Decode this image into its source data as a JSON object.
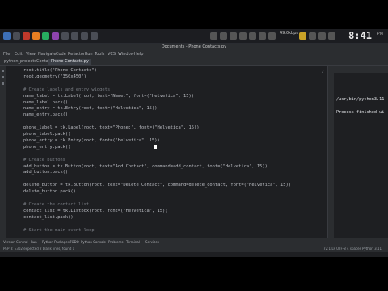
{
  "system": {
    "clock": "8:41",
    "clock_small": "PM",
    "tray_text": "49.0kbps",
    "desk_text": "0:0"
  },
  "window": {
    "title": "Documents - Phone Contacts.py"
  },
  "menu": {
    "items": [
      "File",
      "Edit",
      "View",
      "Navigate",
      "Code",
      "Refactor",
      "Run",
      "Tools",
      "VCS",
      "Window",
      "Help"
    ]
  },
  "tabs": [
    {
      "label": "python_projects"
    },
    {
      "label": "Contacts"
    },
    {
      "label": "Phone Contacts.py"
    }
  ],
  "editor": {
    "lines": [
      {
        "parts": [
          [
            "",
            "root.title(\"Phone Contacts\")"
          ]
        ]
      },
      {
        "parts": [
          [
            "",
            "root.geometry(\"350x450\")"
          ]
        ]
      },
      {
        "parts": [
          [
            "",
            ""
          ]
        ]
      },
      {
        "parts": [
          [
            "cm",
            "# Create labels and entry widgets"
          ]
        ]
      },
      {
        "parts": [
          [
            "",
            "name_label = tk.Label(root, text=\"Name:\", font=(\"Helvetica\", 15))"
          ]
        ]
      },
      {
        "parts": [
          [
            "",
            "name_label.pack()"
          ]
        ]
      },
      {
        "parts": [
          [
            "",
            "name_entry = tk.Entry(root, font=(\"Helvetica\", 15))"
          ]
        ]
      },
      {
        "parts": [
          [
            "",
            "name_entry.pack()"
          ]
        ]
      },
      {
        "parts": [
          [
            "",
            ""
          ]
        ]
      },
      {
        "parts": [
          [
            "",
            "phone_label = tk.Label(root, text=\"Phone:\", font=(\"Helvetica\", 15))"
          ]
        ]
      },
      {
        "parts": [
          [
            "",
            "phone_label.pack()"
          ]
        ]
      },
      {
        "parts": [
          [
            "",
            "phone_entry = tk.Entry(root, font=(\"Helvetica\", 15))"
          ]
        ]
      },
      {
        "parts": [
          [
            "",
            "phone_entry.pack()"
          ]
        ]
      },
      {
        "parts": [
          [
            "",
            ""
          ]
        ]
      },
      {
        "parts": [
          [
            "cm",
            "# Create buttons"
          ]
        ]
      },
      {
        "parts": [
          [
            "",
            "add_button = tk.Button(root, text=\"Add Contact\", command=add_contact, font=(\"Helvetica\", 15))"
          ]
        ]
      },
      {
        "parts": [
          [
            "",
            "add_button.pack()"
          ]
        ]
      },
      {
        "parts": [
          [
            "",
            ""
          ]
        ]
      },
      {
        "parts": [
          [
            "",
            "delete_button = tk.Button(root, text=\"Delete Contact\", command=delete_contact, font=(\"Helvetica\", 15))"
          ]
        ]
      },
      {
        "parts": [
          [
            "",
            "delete_button.pack()"
          ]
        ]
      },
      {
        "parts": [
          [
            "",
            ""
          ]
        ]
      },
      {
        "parts": [
          [
            "cm",
            "# Create the contact list"
          ]
        ]
      },
      {
        "parts": [
          [
            "",
            "contact_list = tk.Listbox(root, font=(\"Helvetica\", 15))"
          ]
        ]
      },
      {
        "parts": [
          [
            "",
            "contact_list.pack()"
          ]
        ]
      },
      {
        "parts": [
          [
            "",
            ""
          ]
        ]
      },
      {
        "parts": [
          [
            "cm",
            "# Start the main event loop"
          ]
        ]
      }
    ]
  },
  "run_panel": {
    "lines": [
      "/usr/bin/python3.11",
      "",
      "Process finished wi"
    ]
  },
  "bottom_tabs": [
    "Version Control",
    "Run",
    "Python Packages",
    "TODO",
    "Python Console",
    "Problems",
    "Terminal",
    "Services"
  ],
  "status": {
    "left": "PEP 8: E302 expected 2 blank lines, found 1",
    "right": "72:1  LF  UTF-8  4 spaces  Python 3.11"
  },
  "colors": {
    "background": "#1e1f22",
    "panel": "#2b2d30",
    "keyword": "#cf8e6d",
    "string": "#6aab73",
    "comment": "#7a7e85"
  }
}
